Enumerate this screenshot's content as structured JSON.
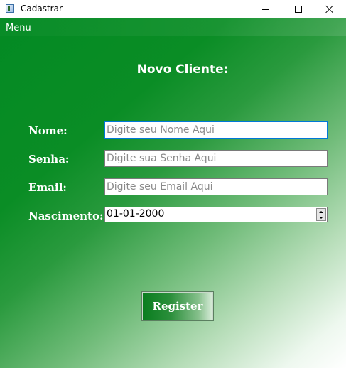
{
  "window": {
    "title": "Cadastrar",
    "app_icon": "window-app-icon",
    "controls": {
      "minimize_icon": "minimize-icon",
      "maximize_icon": "maximize-icon",
      "close_icon": "close-icon"
    }
  },
  "menubar": {
    "items": [
      {
        "label": "Menu"
      }
    ]
  },
  "form": {
    "heading": "Novo Cliente:",
    "fields": {
      "nome": {
        "label": "Nome:",
        "placeholder": "Digite seu Nome Aqui",
        "value": ""
      },
      "senha": {
        "label": "Senha:",
        "placeholder": "Digite sua Senha Aqui",
        "value": ""
      },
      "email": {
        "label": "Email:",
        "placeholder": "Digite seu Email Aqui",
        "value": ""
      },
      "nascimento": {
        "label": "Nascimento:",
        "value": "01-01-2000"
      }
    },
    "submit_label": "Register"
  },
  "colors": {
    "background_start": "#038a23",
    "background_end": "#ffffff",
    "focus_border": "#0078d7",
    "text_on_green": "#ffffff"
  }
}
